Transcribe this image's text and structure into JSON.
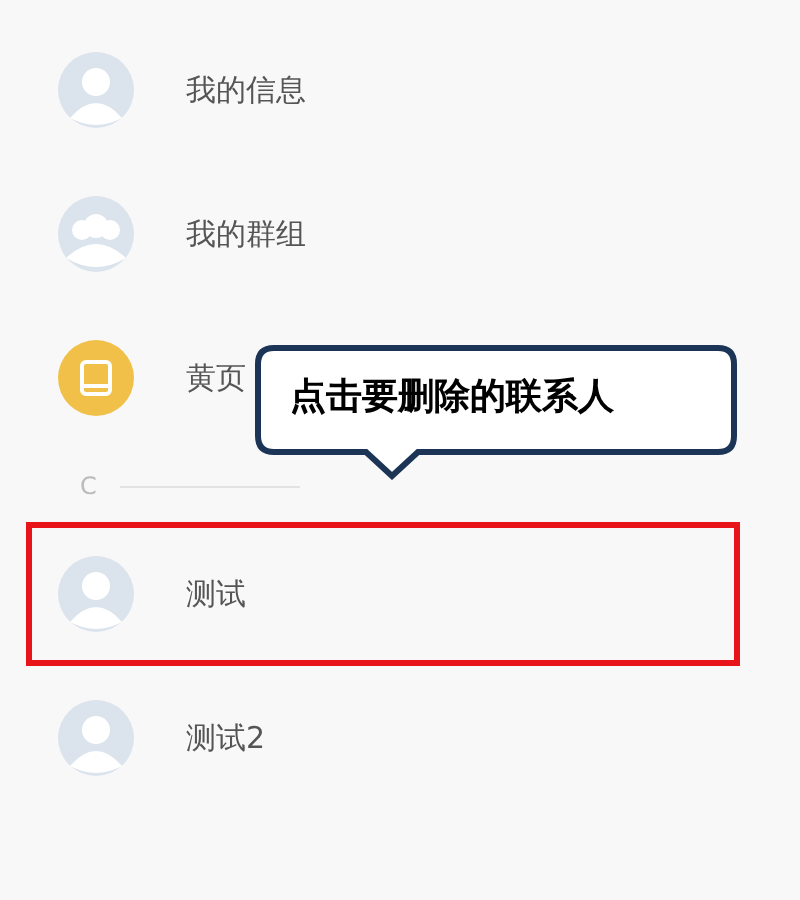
{
  "contacts_top": [
    {
      "name": "我的信息",
      "kind": "person",
      "highlighted": false
    },
    {
      "name": "我的群组",
      "kind": "group",
      "highlighted": false
    },
    {
      "name": "黄页",
      "kind": "yellowpages",
      "highlighted": false
    }
  ],
  "section": {
    "letter": "C",
    "contacts": [
      {
        "name": "测试",
        "kind": "person",
        "highlighted": true
      },
      {
        "name": "测试2",
        "kind": "person",
        "highlighted": false
      }
    ]
  },
  "callout": {
    "text": "点击要删除的联系人"
  }
}
